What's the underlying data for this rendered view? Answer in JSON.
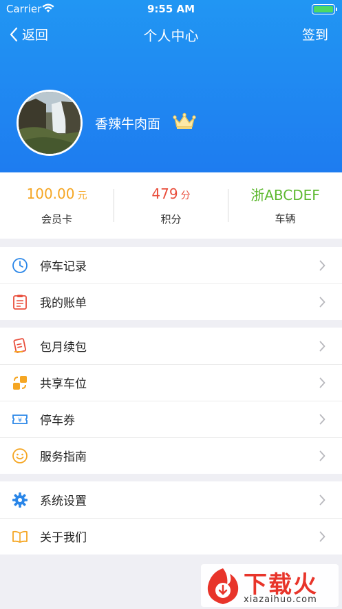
{
  "status_bar": {
    "carrier": "Carrier",
    "time": "9:55 AM"
  },
  "nav": {
    "back_label": "返回",
    "title": "个人中心",
    "right_label": "签到"
  },
  "profile": {
    "username": "香辣牛肉面"
  },
  "stats": [
    {
      "value": "100.00",
      "unit": "元",
      "label": "会员卡",
      "color": "#f5a623"
    },
    {
      "value": "479",
      "unit": "分",
      "label": "积分",
      "color": "#e94e3c"
    },
    {
      "value": "浙ABCDEF",
      "unit": "",
      "label": "车辆",
      "color": "#5cb82e"
    }
  ],
  "menu": {
    "group1": [
      {
        "label": "停车记录",
        "icon": "clock-icon"
      },
      {
        "label": "我的账单",
        "icon": "bill-icon"
      }
    ],
    "group2": [
      {
        "label": "包月续包",
        "icon": "package-icon"
      },
      {
        "label": "共享车位",
        "icon": "share-icon"
      },
      {
        "label": "停车券",
        "icon": "ticket-icon"
      },
      {
        "label": "服务指南",
        "icon": "smile-icon"
      }
    ],
    "group3": [
      {
        "label": "系统设置",
        "icon": "gear-icon"
      },
      {
        "label": "关于我们",
        "icon": "book-icon"
      }
    ]
  },
  "watermark": {
    "main": "下载火",
    "sub": "xiazaihuo.com"
  },
  "colors": {
    "header": "#1e88f0",
    "accent_blue": "#2a86e8",
    "accent_orange": "#f5a623",
    "accent_red": "#e94e3c"
  }
}
